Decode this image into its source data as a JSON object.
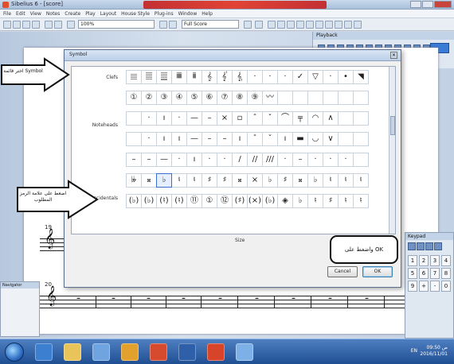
{
  "window": {
    "title": "Sibelius 6 - [score]"
  },
  "menubar": [
    "File",
    "Edit",
    "View",
    "Notes",
    "Create",
    "Play",
    "Layout",
    "House Style",
    "Plug-ins",
    "Window",
    "Help"
  ],
  "toolbar": {
    "zoom_value": "100%",
    "font_value": "Full Score"
  },
  "palette_right": {
    "title": "Playback"
  },
  "score": {
    "measure_number_upper": "19",
    "measure_number_lower": "20"
  },
  "navigator": {
    "title": "Navigator"
  },
  "keypad": {
    "title": "Keypad",
    "keys": [
      "1",
      "2",
      "3",
      "4",
      "5",
      "6",
      "7",
      "8",
      "9",
      "+",
      "-",
      "0"
    ]
  },
  "dialog": {
    "title": "Symbol",
    "close_glyph": "✕",
    "row_labels": {
      "clefs": "Clefs",
      "noteheads": "Noteheads",
      "accidentals": "Accidentals"
    },
    "rows": [
      [
        "𝄙",
        "𝄚",
        "𝄛",
        "𝄜",
        "𝄝",
        "𝄞",
        "𝄟",
        "𝄠",
        "·",
        "·",
        "·",
        "✓",
        "▽",
        "·",
        "•",
        "◥"
      ],
      [
        "①",
        "②",
        "③",
        "④",
        "⑤",
        "⑥",
        "⑦",
        "⑧",
        "⑨",
        "〰",
        "",
        "",
        "",
        "",
        "",
        ""
      ],
      [
        "",
        "·",
        "ı",
        "·",
        "—",
        "–",
        "×",
        "▫",
        "ˆ",
        "ˇ",
        "⌒",
        "╤",
        "◠",
        "∧",
        "",
        ""
      ],
      [
        "",
        "·",
        "ı",
        "ı",
        "—",
        "–",
        "–",
        "ı",
        "ˆ",
        "ˇ",
        "ı",
        "▬",
        "◡",
        "∨",
        "",
        ""
      ],
      [
        "–",
        "–",
        "—",
        "·",
        "ı",
        "·",
        "·",
        "/",
        "//",
        "///",
        "·",
        "–",
        "·",
        "·",
        "·",
        ""
      ],
      [
        "𝄫",
        "𝄪",
        "♭",
        "♮",
        "♮",
        "♯",
        "♯",
        "𝄪",
        "×",
        "♭",
        "♯",
        "𝄪",
        "♭",
        "♮",
        "♮",
        "♮"
      ],
      [
        "(♭)",
        "(♭)",
        "(♮)",
        "(♮)",
        "⑪",
        "①",
        "⑫",
        "(♯)",
        "(×)",
        "(♭)",
        "◈",
        "♭",
        "♮",
        "♯",
        "♮",
        "♮"
      ]
    ],
    "selected": {
      "row": 5,
      "col": 2
    },
    "size_label": "Size",
    "buttons": {
      "cancel": "Cancel",
      "ok": "OK"
    }
  },
  "annotations": {
    "top_left": "اختر قائمة Symbol",
    "middle_left": "اضغط على علامة الرمز المطلوب",
    "bottom_right": "واضغط على OK"
  },
  "taskbar": {
    "tray_text": "EN",
    "clock_time": "09:50 ص",
    "clock_date": "2016/11/01"
  },
  "colors": {
    "accent": "#3a6fd1",
    "title_red": "#e33c2c",
    "taskbar": "#2a5aa0"
  }
}
